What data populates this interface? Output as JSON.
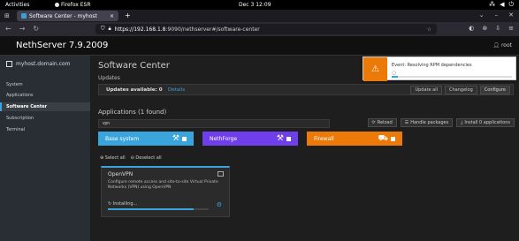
{
  "gnome": {
    "activities": "Activities",
    "app_name": "Firefox ESR",
    "clock": "Dec 3  12:09"
  },
  "browser": {
    "tab_title": "Software Center - myhost",
    "new_tab": "+",
    "tab_close": "×",
    "url_host": "https://192.168.1.8",
    "url_path": ":9090/nethserver#/software-center"
  },
  "header": {
    "brand": "NethServer 7.9.2009",
    "user": "root"
  },
  "sidebar": {
    "hostname": "myhost.domain.com",
    "items": [
      {
        "label": "System"
      },
      {
        "label": "Applications"
      },
      {
        "label": "Software Center"
      },
      {
        "label": "Subscription"
      },
      {
        "label": "Terminal"
      }
    ]
  },
  "main": {
    "title": "Software Center",
    "updates_heading": "Updates",
    "updates_available": "Updates available: 0",
    "details_link": "Details",
    "update_buttons": [
      {
        "label": "Update all"
      },
      {
        "label": "Changelog"
      },
      {
        "label": "Configure"
      }
    ],
    "apps_heading": "Applications (1 found)",
    "search_value": "vpn",
    "tool_buttons": [
      {
        "label": "Reload"
      },
      {
        "label": "Handle packages"
      },
      {
        "label": "Install 0 applications"
      }
    ],
    "filters": [
      {
        "label": "Base system",
        "color": "#39a5dc"
      },
      {
        "label": "NethForge",
        "color": "#703fec"
      },
      {
        "label": "Firewall",
        "color": "#ec7a08"
      }
    ],
    "select_all": "Select all",
    "deselect_all": "Deselect all",
    "app_card": {
      "name": "OpenVPN",
      "description": "Configure remote access and site-to-site Virtual Private Networks (VPN) using OpenVPN",
      "status": "Installing...",
      "progress": 0.85
    }
  },
  "toast": {
    "message": "Event: Resolving RPM dependencies",
    "spinner": "◌",
    "progress": 0.05,
    "accent": "#ec7a08"
  }
}
